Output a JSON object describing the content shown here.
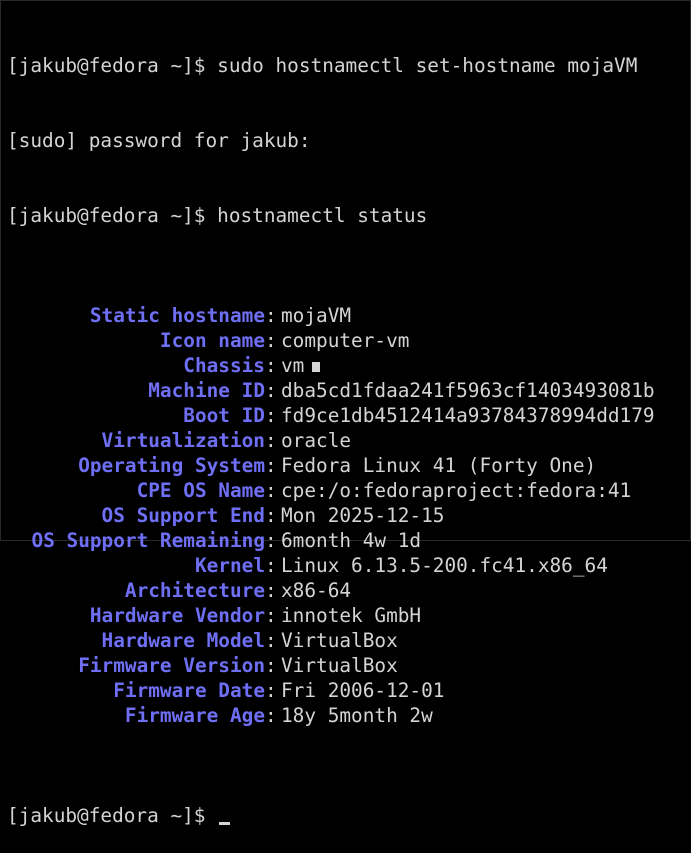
{
  "terminal": {
    "lines": [
      {
        "type": "prompt",
        "prompt": "[jakub@fedora ~]$ ",
        "command": "sudo hostnamectl set-hostname mojaVM"
      },
      {
        "type": "text",
        "text": "[sudo] password for jakub:"
      },
      {
        "type": "prompt",
        "prompt": "[jakub@fedora ~]$ ",
        "command": "hostnamectl status"
      }
    ],
    "status": [
      {
        "key": "Static hostname",
        "value": "mojaVM"
      },
      {
        "key": "Icon name",
        "value": "computer-vm"
      },
      {
        "key": "Chassis",
        "value": "vm",
        "icon": "chassis-vm-icon"
      },
      {
        "key": "Machine ID",
        "value": "dba5cd1fdaa241f5963cf1403493081b"
      },
      {
        "key": "Boot ID",
        "value": "fd9ce1db4512414a93784378994dd179"
      },
      {
        "key": "Virtualization",
        "value": "oracle"
      },
      {
        "key": "Operating System",
        "value": "Fedora Linux 41 (Forty One)"
      },
      {
        "key": "CPE OS Name",
        "value": "cpe:/o:fedoraproject:fedora:41"
      },
      {
        "key": "OS Support End",
        "value": "Mon 2025-12-15"
      },
      {
        "key": "OS Support Remaining",
        "value": "6month 4w 1d"
      },
      {
        "key": "Kernel",
        "value": "Linux 6.13.5-200.fc41.x86_64"
      },
      {
        "key": "Architecture",
        "value": "x86-64"
      },
      {
        "key": "Hardware Vendor",
        "value": "innotek GmbH"
      },
      {
        "key": "Hardware Model",
        "value": "VirtualBox"
      },
      {
        "key": "Firmware Version",
        "value": "VirtualBox"
      },
      {
        "key": "Firmware Date",
        "value": "Fri 2006-12-01"
      },
      {
        "key": "Firmware Age",
        "value": "18y 5month 2w"
      }
    ],
    "final_prompt": "[jakub@fedora ~]$ ",
    "separator": ":",
    "colors": {
      "background": "#000000",
      "text": "#d4d4d4",
      "key": "#6f6ff5"
    }
  }
}
